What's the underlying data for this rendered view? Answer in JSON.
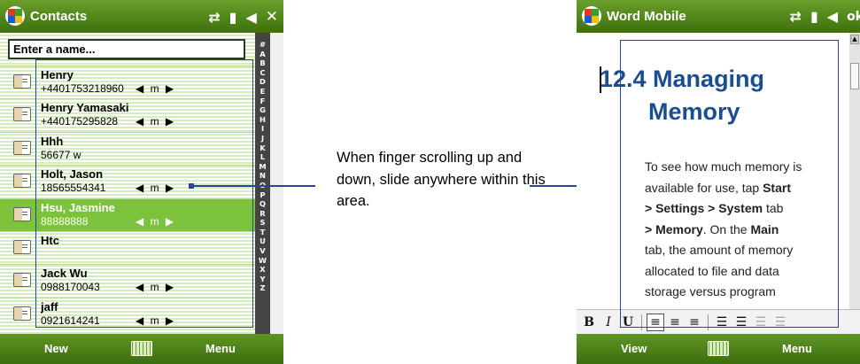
{
  "contacts": {
    "title": "Contacts",
    "search_placeholder": "Enter a name...",
    "entries": [
      {
        "name": "Henry",
        "number": "+4401753218960",
        "type": "m"
      },
      {
        "name": "Henry Yamasaki",
        "number": "+440175295828",
        "type": "m"
      },
      {
        "name": "Hhh",
        "number": "56677  w",
        "type": ""
      },
      {
        "name": "Holt, Jason",
        "number": "18565554341",
        "type": "m"
      },
      {
        "name": "Hsu, Jasmine",
        "number": "88888888",
        "type": "m"
      },
      {
        "name": "Htc",
        "number": "",
        "type": ""
      },
      {
        "name": "Jack Wu",
        "number": "0988170043",
        "type": "m"
      },
      {
        "name": "jaff",
        "number": "0921614241",
        "type": "m"
      }
    ],
    "selected_index": 4,
    "alphabet": [
      "#",
      "A",
      "B",
      "C",
      "D",
      "E",
      "F",
      "G",
      "H",
      "I",
      "J",
      "K",
      "L",
      "M",
      "N",
      "O",
      "P",
      "Q",
      "R",
      "S",
      "T",
      "U",
      "V",
      "W",
      "X",
      "Y",
      "Z"
    ],
    "softkey_left": "New",
    "softkey_right": "Menu"
  },
  "word": {
    "title": "Word Mobile",
    "ok_label": "ok",
    "heading_line1": "12.4  Managing",
    "heading_line2": "Memory",
    "body_lines": [
      "To see how much memory is",
      "available for use, tap Start",
      "> Settings > System tab",
      "> Memory. On the Main",
      "tab, the amount of memory",
      "allocated to file and data",
      "storage versus program"
    ],
    "softkey_left": "View",
    "softkey_right": "Menu"
  },
  "annotation": {
    "text": "When finger scrolling up and down, slide anywhere within this area."
  },
  "colors": {
    "titlebar": "#4e8418",
    "selection": "#7cc23a",
    "heading": "#1b4d91",
    "callout": "#2545a0"
  }
}
